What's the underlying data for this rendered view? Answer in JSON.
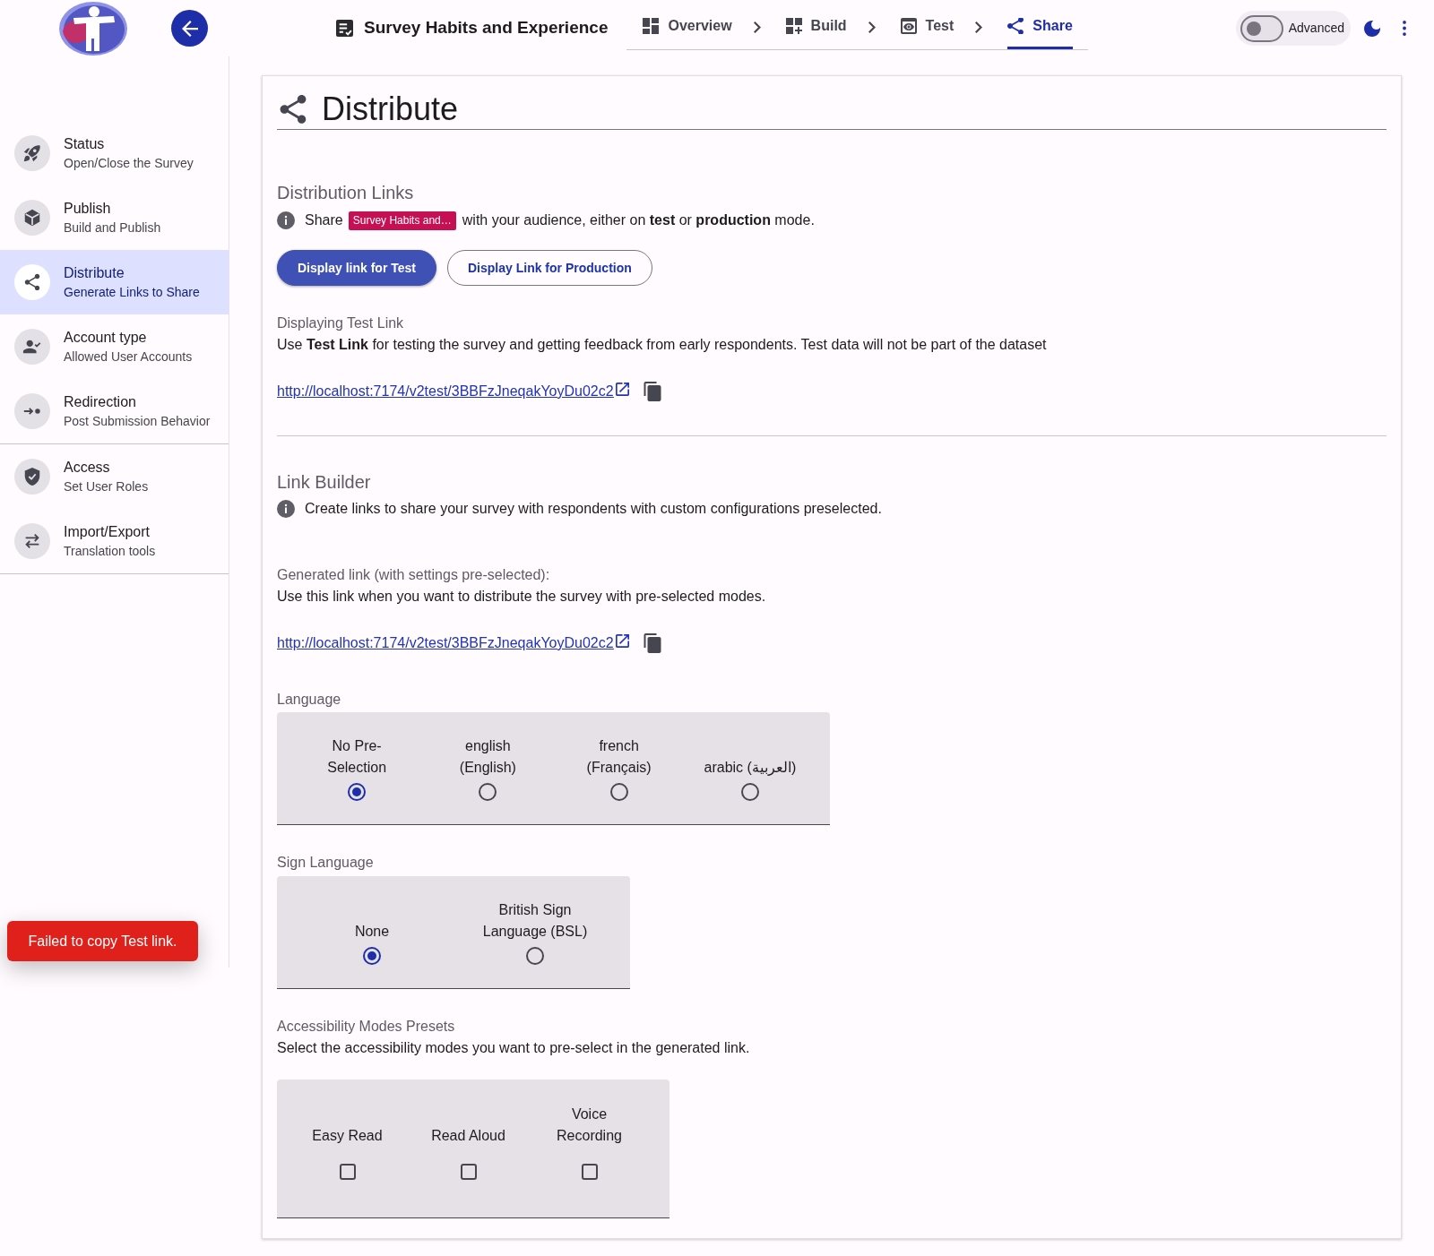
{
  "app_bar": {
    "title": "Survey Habits and Experience",
    "steps": [
      {
        "label": "Overview",
        "selected": false
      },
      {
        "label": "Build",
        "selected": false
      },
      {
        "label": "Test",
        "selected": false
      },
      {
        "label": "Share",
        "selected": true
      }
    ],
    "advanced": {
      "label": "Advanced",
      "on": false
    }
  },
  "sidebar": {
    "groups": [
      {
        "items": [
          {
            "title": "Status",
            "subtitle": "Open/Close the Survey",
            "selected": false
          },
          {
            "title": "Publish",
            "subtitle": "Build and Publish",
            "selected": false
          },
          {
            "title": "Distribute",
            "subtitle": "Generate Links to Share",
            "selected": true
          },
          {
            "title": "Account type",
            "subtitle": "Allowed User Accounts",
            "selected": false
          },
          {
            "title": "Redirection",
            "subtitle": "Post Submission Behavior",
            "selected": false
          }
        ]
      },
      {
        "items": [
          {
            "title": "Access",
            "subtitle": "Set User Roles",
            "selected": false
          },
          {
            "title": "Import/Export",
            "subtitle": "Translation tools",
            "selected": false
          }
        ]
      }
    ]
  },
  "main": {
    "title": "Distribute",
    "distribution_links": {
      "title": "Distribution Links",
      "info": {
        "before": "Share",
        "chip": "Survey Habits and…",
        "after": "with your audience, either on **test** or **production** mode."
      },
      "buttons": [
        {
          "label": "Display link for Test",
          "selected": true
        },
        {
          "label": "Display Link for Production",
          "selected": false
        }
      ],
      "subtitle": "Displaying Test Link",
      "description": "Use **Test Link** for testing the survey and getting feedback from early respondents. Test data will not be part of the dataset",
      "link": "http://localhost:7174/v2test/3BBFzJneqakYoyDu02c2"
    },
    "link_builder": {
      "title": "Link Builder",
      "info": "Create links to share your survey with respondents with custom configurations preselected.",
      "subtitle": "Generated link (with settings pre-selected):",
      "description": "Use this link when you want to distribute the survey with pre-selected modes.",
      "link": "http://localhost:7174/v2test/3BBFzJneqakYoyDu02c2",
      "language": {
        "label": "Language",
        "options": [
          {
            "label": "No Pre-Selection",
            "selected": true
          },
          {
            "label": "english (English)",
            "selected": false
          },
          {
            "label": "french (Français)",
            "selected": false
          },
          {
            "label": "arabic (العربية)",
            "selected": false
          }
        ]
      },
      "sign_language": {
        "label": "Sign Language",
        "options": [
          {
            "label": "None",
            "selected": true
          },
          {
            "label": "British Sign Language (BSL)",
            "selected": false
          }
        ]
      },
      "accessibility_presets": {
        "label": "Accessibility Modes Presets",
        "description": "Select the accessibility modes you want to pre-select in the generated link.",
        "options": [
          {
            "label": "Easy Read",
            "checked": false
          },
          {
            "label": "Read Aloud",
            "checked": false
          },
          {
            "label": "Voice Recording",
            "checked": false
          }
        ]
      }
    }
  },
  "toast": {
    "message": "Failed to copy Test link."
  }
}
